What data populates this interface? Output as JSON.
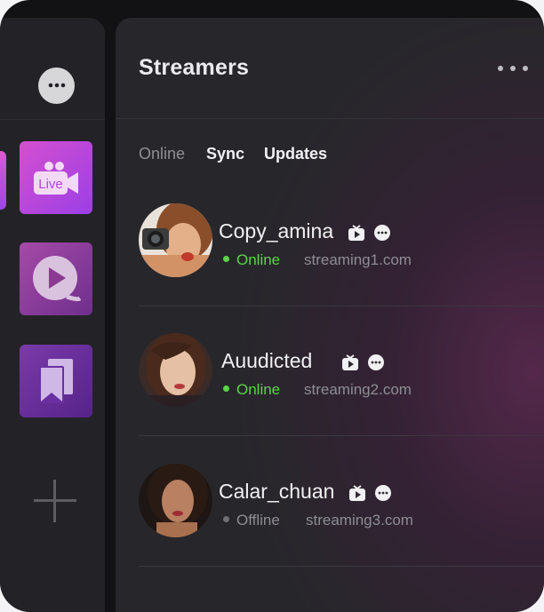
{
  "header": {
    "title": "Streamers"
  },
  "tabs": [
    {
      "label": "Online",
      "state": "inactive"
    },
    {
      "label": "Sync",
      "state": "active"
    },
    {
      "label": "Updates",
      "state": "active"
    }
  ],
  "sidebar": {
    "items": [
      {
        "icon": "chat-bubble-icon"
      },
      {
        "icon": "live-camera-icon",
        "label": "Live",
        "active": true
      },
      {
        "icon": "play-icon"
      },
      {
        "icon": "bookmark-stack-icon"
      },
      {
        "icon": "plus-icon"
      }
    ]
  },
  "streamers": [
    {
      "name": "Copy_amina",
      "status": "Online",
      "site": "streaming1.com"
    },
    {
      "name": "Auudicted",
      "status": "Online",
      "site": "streaming2.com"
    },
    {
      "name": "Calar_chuan",
      "status": "Offline",
      "site": "streaming3.com"
    }
  ],
  "colors": {
    "online": "#5cd34a",
    "offline": "#8d8d93",
    "accent": "#c34cdc",
    "background": "#27272b"
  }
}
